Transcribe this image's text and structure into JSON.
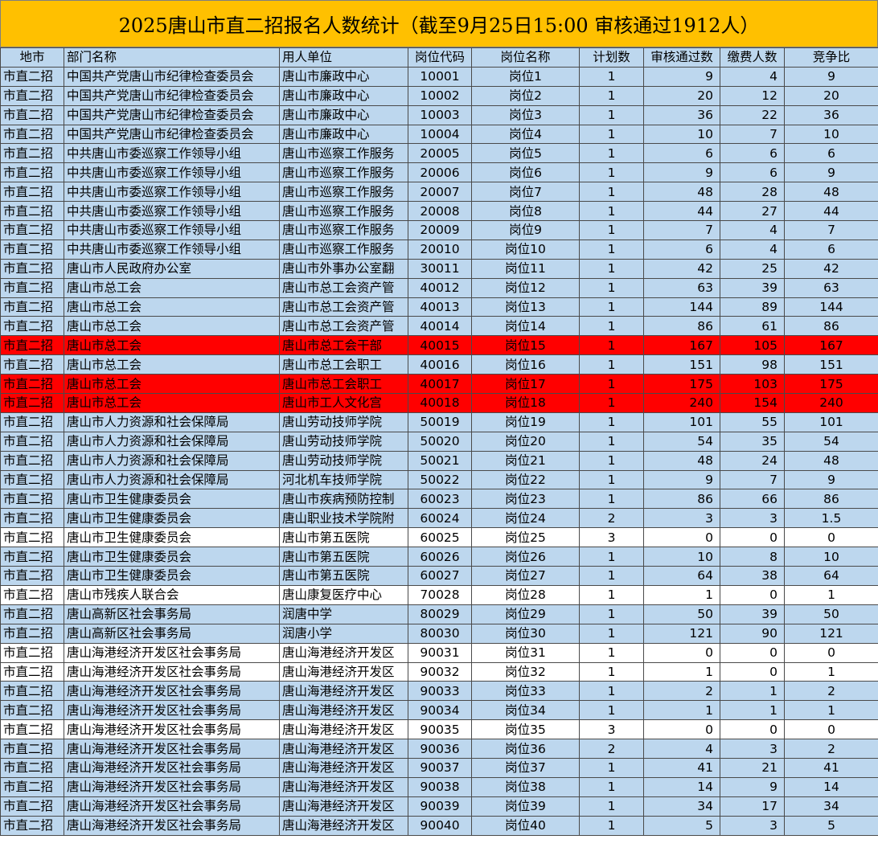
{
  "title": "2025唐山市直二招报名人数统计（截至9月25日15:00  审核通过1912人）",
  "colors": {
    "title_bg": "#FFC000",
    "row_blue": "#BDD7EE",
    "row_white": "#FFFFFF",
    "row_red": "#FF0000"
  },
  "headers": [
    "地市",
    "部门名称",
    "用人单位",
    "岗位代码",
    "岗位名称",
    "计划数",
    "审核通过数",
    "缴费人数",
    "竞争比"
  ],
  "rows": [
    {
      "city": "市直二招",
      "dept": "中国共产党唐山市纪律检查委员会",
      "unit": "唐山市廉政中心",
      "code": "10001",
      "post": "岗位1",
      "plan": "1",
      "passed": "9",
      "paid": "4",
      "ratio": "9",
      "hl": "blue"
    },
    {
      "city": "市直二招",
      "dept": "中国共产党唐山市纪律检查委员会",
      "unit": "唐山市廉政中心",
      "code": "10002",
      "post": "岗位2",
      "plan": "1",
      "passed": "20",
      "paid": "12",
      "ratio": "20",
      "hl": "blue"
    },
    {
      "city": "市直二招",
      "dept": "中国共产党唐山市纪律检查委员会",
      "unit": "唐山市廉政中心",
      "code": "10003",
      "post": "岗位3",
      "plan": "1",
      "passed": "36",
      "paid": "22",
      "ratio": "36",
      "hl": "blue"
    },
    {
      "city": "市直二招",
      "dept": "中国共产党唐山市纪律检查委员会",
      "unit": "唐山市廉政中心",
      "code": "10004",
      "post": "岗位4",
      "plan": "1",
      "passed": "10",
      "paid": "7",
      "ratio": "10",
      "hl": "blue"
    },
    {
      "city": "市直二招",
      "dept": "中共唐山市委巡察工作领导小组",
      "unit": "唐山市巡察工作服务",
      "code": "20005",
      "post": "岗位5",
      "plan": "1",
      "passed": "6",
      "paid": "6",
      "ratio": "6",
      "hl": "blue"
    },
    {
      "city": "市直二招",
      "dept": "中共唐山市委巡察工作领导小组",
      "unit": "唐山市巡察工作服务",
      "code": "20006",
      "post": "岗位6",
      "plan": "1",
      "passed": "9",
      "paid": "6",
      "ratio": "9",
      "hl": "blue"
    },
    {
      "city": "市直二招",
      "dept": "中共唐山市委巡察工作领导小组",
      "unit": "唐山市巡察工作服务",
      "code": "20007",
      "post": "岗位7",
      "plan": "1",
      "passed": "48",
      "paid": "28",
      "ratio": "48",
      "hl": "blue"
    },
    {
      "city": "市直二招",
      "dept": "中共唐山市委巡察工作领导小组",
      "unit": "唐山市巡察工作服务",
      "code": "20008",
      "post": "岗位8",
      "plan": "1",
      "passed": "44",
      "paid": "27",
      "ratio": "44",
      "hl": "blue"
    },
    {
      "city": "市直二招",
      "dept": "中共唐山市委巡察工作领导小组",
      "unit": "唐山市巡察工作服务",
      "code": "20009",
      "post": "岗位9",
      "plan": "1",
      "passed": "7",
      "paid": "4",
      "ratio": "7",
      "hl": "blue"
    },
    {
      "city": "市直二招",
      "dept": "中共唐山市委巡察工作领导小组",
      "unit": "唐山市巡察工作服务",
      "code": "20010",
      "post": "岗位10",
      "plan": "1",
      "passed": "6",
      "paid": "4",
      "ratio": "6",
      "hl": "blue"
    },
    {
      "city": "市直二招",
      "dept": "唐山市人民政府办公室",
      "unit": "唐山市外事办公室翻",
      "code": "30011",
      "post": "岗位11",
      "plan": "1",
      "passed": "42",
      "paid": "25",
      "ratio": "42",
      "hl": "blue"
    },
    {
      "city": "市直二招",
      "dept": "唐山市总工会",
      "unit": "唐山市总工会资产管",
      "code": "40012",
      "post": "岗位12",
      "plan": "1",
      "passed": "63",
      "paid": "39",
      "ratio": "63",
      "hl": "blue"
    },
    {
      "city": "市直二招",
      "dept": "唐山市总工会",
      "unit": "唐山市总工会资产管",
      "code": "40013",
      "post": "岗位13",
      "plan": "1",
      "passed": "144",
      "paid": "89",
      "ratio": "144",
      "hl": "blue"
    },
    {
      "city": "市直二招",
      "dept": "唐山市总工会",
      "unit": "唐山市总工会资产管",
      "code": "40014",
      "post": "岗位14",
      "plan": "1",
      "passed": "86",
      "paid": "61",
      "ratio": "86",
      "hl": "blue"
    },
    {
      "city": "市直二招",
      "dept": "唐山市总工会",
      "unit": "唐山市总工会干部",
      "code": "40015",
      "post": "岗位15",
      "plan": "1",
      "passed": "167",
      "paid": "105",
      "ratio": "167",
      "hl": "red"
    },
    {
      "city": "市直二招",
      "dept": "唐山市总工会",
      "unit": "唐山市总工会职工",
      "code": "40016",
      "post": "岗位16",
      "plan": "1",
      "passed": "151",
      "paid": "98",
      "ratio": "151",
      "hl": "blue"
    },
    {
      "city": "市直二招",
      "dept": "唐山市总工会",
      "unit": "唐山市总工会职工",
      "code": "40017",
      "post": "岗位17",
      "plan": "1",
      "passed": "175",
      "paid": "103",
      "ratio": "175",
      "hl": "red"
    },
    {
      "city": "市直二招",
      "dept": "唐山市总工会",
      "unit": "唐山市工人文化宫",
      "code": "40018",
      "post": "岗位18",
      "plan": "1",
      "passed": "240",
      "paid": "154",
      "ratio": "240",
      "hl": "red"
    },
    {
      "city": "市直二招",
      "dept": "唐山市人力资源和社会保障局",
      "unit": "唐山劳动技师学院",
      "code": "50019",
      "post": "岗位19",
      "plan": "1",
      "passed": "101",
      "paid": "55",
      "ratio": "101",
      "hl": "blue"
    },
    {
      "city": "市直二招",
      "dept": "唐山市人力资源和社会保障局",
      "unit": "唐山劳动技师学院",
      "code": "50020",
      "post": "岗位20",
      "plan": "1",
      "passed": "54",
      "paid": "35",
      "ratio": "54",
      "hl": "blue"
    },
    {
      "city": "市直二招",
      "dept": "唐山市人力资源和社会保障局",
      "unit": "唐山劳动技师学院",
      "code": "50021",
      "post": "岗位21",
      "plan": "1",
      "passed": "48",
      "paid": "24",
      "ratio": "48",
      "hl": "blue"
    },
    {
      "city": "市直二招",
      "dept": "唐山市人力资源和社会保障局",
      "unit": "河北机车技师学院",
      "code": "50022",
      "post": "岗位22",
      "plan": "1",
      "passed": "9",
      "paid": "7",
      "ratio": "9",
      "hl": "blue"
    },
    {
      "city": "市直二招",
      "dept": "唐山市卫生健康委员会",
      "unit": "唐山市疾病预防控制",
      "code": "60023",
      "post": "岗位23",
      "plan": "1",
      "passed": "86",
      "paid": "66",
      "ratio": "86",
      "hl": "blue"
    },
    {
      "city": "市直二招",
      "dept": "唐山市卫生健康委员会",
      "unit": "唐山职业技术学院附",
      "code": "60024",
      "post": "岗位24",
      "plan": "2",
      "passed": "3",
      "paid": "3",
      "ratio": "1.5",
      "hl": "blue"
    },
    {
      "city": "市直二招",
      "dept": "唐山市卫生健康委员会",
      "unit": "唐山市第五医院",
      "code": "60025",
      "post": "岗位25",
      "plan": "3",
      "passed": "0",
      "paid": "0",
      "ratio": "0",
      "hl": "white"
    },
    {
      "city": "市直二招",
      "dept": "唐山市卫生健康委员会",
      "unit": "唐山市第五医院",
      "code": "60026",
      "post": "岗位26",
      "plan": "1",
      "passed": "10",
      "paid": "8",
      "ratio": "10",
      "hl": "blue"
    },
    {
      "city": "市直二招",
      "dept": "唐山市卫生健康委员会",
      "unit": "唐山市第五医院",
      "code": "60027",
      "post": "岗位27",
      "plan": "1",
      "passed": "64",
      "paid": "38",
      "ratio": "64",
      "hl": "blue"
    },
    {
      "city": "市直二招",
      "dept": "唐山市残疾人联合会",
      "unit": "唐山康复医疗中心",
      "code": "70028",
      "post": "岗位28",
      "plan": "1",
      "passed": "1",
      "paid": "0",
      "ratio": "1",
      "hl": "white"
    },
    {
      "city": "市直二招",
      "dept": "唐山高新区社会事务局",
      "unit": "润唐中学",
      "code": "80029",
      "post": "岗位29",
      "plan": "1",
      "passed": "50",
      "paid": "39",
      "ratio": "50",
      "hl": "blue"
    },
    {
      "city": "市直二招",
      "dept": "唐山高新区社会事务局",
      "unit": "润唐小学",
      "code": "80030",
      "post": "岗位30",
      "plan": "1",
      "passed": "121",
      "paid": "90",
      "ratio": "121",
      "hl": "blue"
    },
    {
      "city": "市直二招",
      "dept": "唐山海港经济开发区社会事务局",
      "unit": "唐山海港经济开发区",
      "code": "90031",
      "post": "岗位31",
      "plan": "1",
      "passed": "0",
      "paid": "0",
      "ratio": "0",
      "hl": "white"
    },
    {
      "city": "市直二招",
      "dept": "唐山海港经济开发区社会事务局",
      "unit": "唐山海港经济开发区",
      "code": "90032",
      "post": "岗位32",
      "plan": "1",
      "passed": "1",
      "paid": "0",
      "ratio": "1",
      "hl": "white"
    },
    {
      "city": "市直二招",
      "dept": "唐山海港经济开发区社会事务局",
      "unit": "唐山海港经济开发区",
      "code": "90033",
      "post": "岗位33",
      "plan": "1",
      "passed": "2",
      "paid": "1",
      "ratio": "2",
      "hl": "blue"
    },
    {
      "city": "市直二招",
      "dept": "唐山海港经济开发区社会事务局",
      "unit": "唐山海港经济开发区",
      "code": "90034",
      "post": "岗位34",
      "plan": "1",
      "passed": "1",
      "paid": "1",
      "ratio": "1",
      "hl": "blue"
    },
    {
      "city": "市直二招",
      "dept": "唐山海港经济开发区社会事务局",
      "unit": "唐山海港经济开发区",
      "code": "90035",
      "post": "岗位35",
      "plan": "3",
      "passed": "0",
      "paid": "0",
      "ratio": "0",
      "hl": "white"
    },
    {
      "city": "市直二招",
      "dept": "唐山海港经济开发区社会事务局",
      "unit": "唐山海港经济开发区",
      "code": "90036",
      "post": "岗位36",
      "plan": "2",
      "passed": "4",
      "paid": "3",
      "ratio": "2",
      "hl": "blue"
    },
    {
      "city": "市直二招",
      "dept": "唐山海港经济开发区社会事务局",
      "unit": "唐山海港经济开发区",
      "code": "90037",
      "post": "岗位37",
      "plan": "1",
      "passed": "41",
      "paid": "21",
      "ratio": "41",
      "hl": "blue"
    },
    {
      "city": "市直二招",
      "dept": "唐山海港经济开发区社会事务局",
      "unit": "唐山海港经济开发区",
      "code": "90038",
      "post": "岗位38",
      "plan": "1",
      "passed": "14",
      "paid": "9",
      "ratio": "14",
      "hl": "blue"
    },
    {
      "city": "市直二招",
      "dept": "唐山海港经济开发区社会事务局",
      "unit": "唐山海港经济开发区",
      "code": "90039",
      "post": "岗位39",
      "plan": "1",
      "passed": "34",
      "paid": "17",
      "ratio": "34",
      "hl": "blue"
    },
    {
      "city": "市直二招",
      "dept": "唐山海港经济开发区社会事务局",
      "unit": "唐山海港经济开发区",
      "code": "90040",
      "post": "岗位40",
      "plan": "1",
      "passed": "5",
      "paid": "3",
      "ratio": "5",
      "hl": "blue"
    }
  ]
}
